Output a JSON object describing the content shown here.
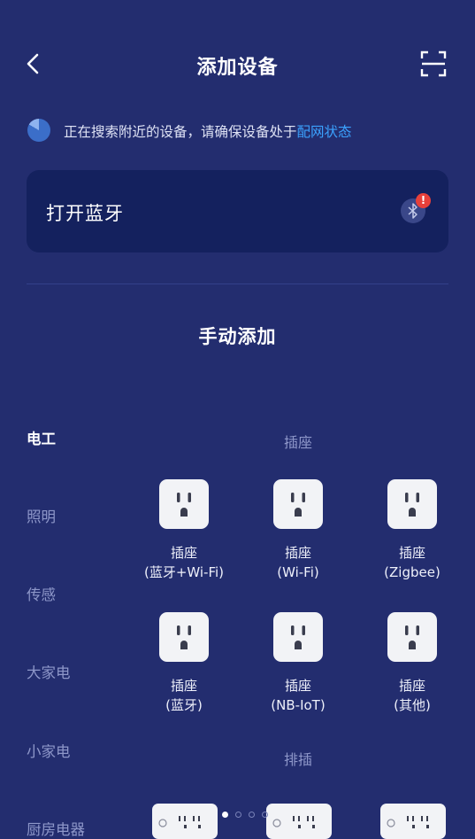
{
  "header": {
    "title": "添加设备",
    "back_icon": "chevron-left-icon",
    "scan_icon": "scan-icon"
  },
  "search": {
    "text": "正在搜索附近的设备，请确保设备处于",
    "link": "配网状态"
  },
  "bluetooth": {
    "label": "打开蓝牙",
    "icon": "bluetooth-icon",
    "badge": "!"
  },
  "manual_title": "手动添加",
  "nav": [
    {
      "label": "电工",
      "active": true
    },
    {
      "label": "照明"
    },
    {
      "label": "传感"
    },
    {
      "label": "大家电"
    },
    {
      "label": "小家电"
    },
    {
      "label": "厨房电器"
    }
  ],
  "sections": [
    {
      "title": "插座",
      "devices": [
        {
          "line1": "插座",
          "line2": "(蓝牙+Wi-Fi)"
        },
        {
          "line1": "插座",
          "line2": "(Wi-Fi)"
        },
        {
          "line1": "插座",
          "line2": "(Zigbee)"
        },
        {
          "line1": "插座",
          "line2": "(蓝牙)"
        },
        {
          "line1": "插座",
          "line2": "(NB-IoT)"
        },
        {
          "line1": "插座",
          "line2": "(其他)"
        }
      ]
    },
    {
      "title": "排插"
    }
  ],
  "pagination": {
    "total": 4,
    "current": 1
  },
  "colors": {
    "background": "#232d6f",
    "card": "#14215e",
    "link": "#3ba2ff",
    "badge": "#e8403a"
  }
}
